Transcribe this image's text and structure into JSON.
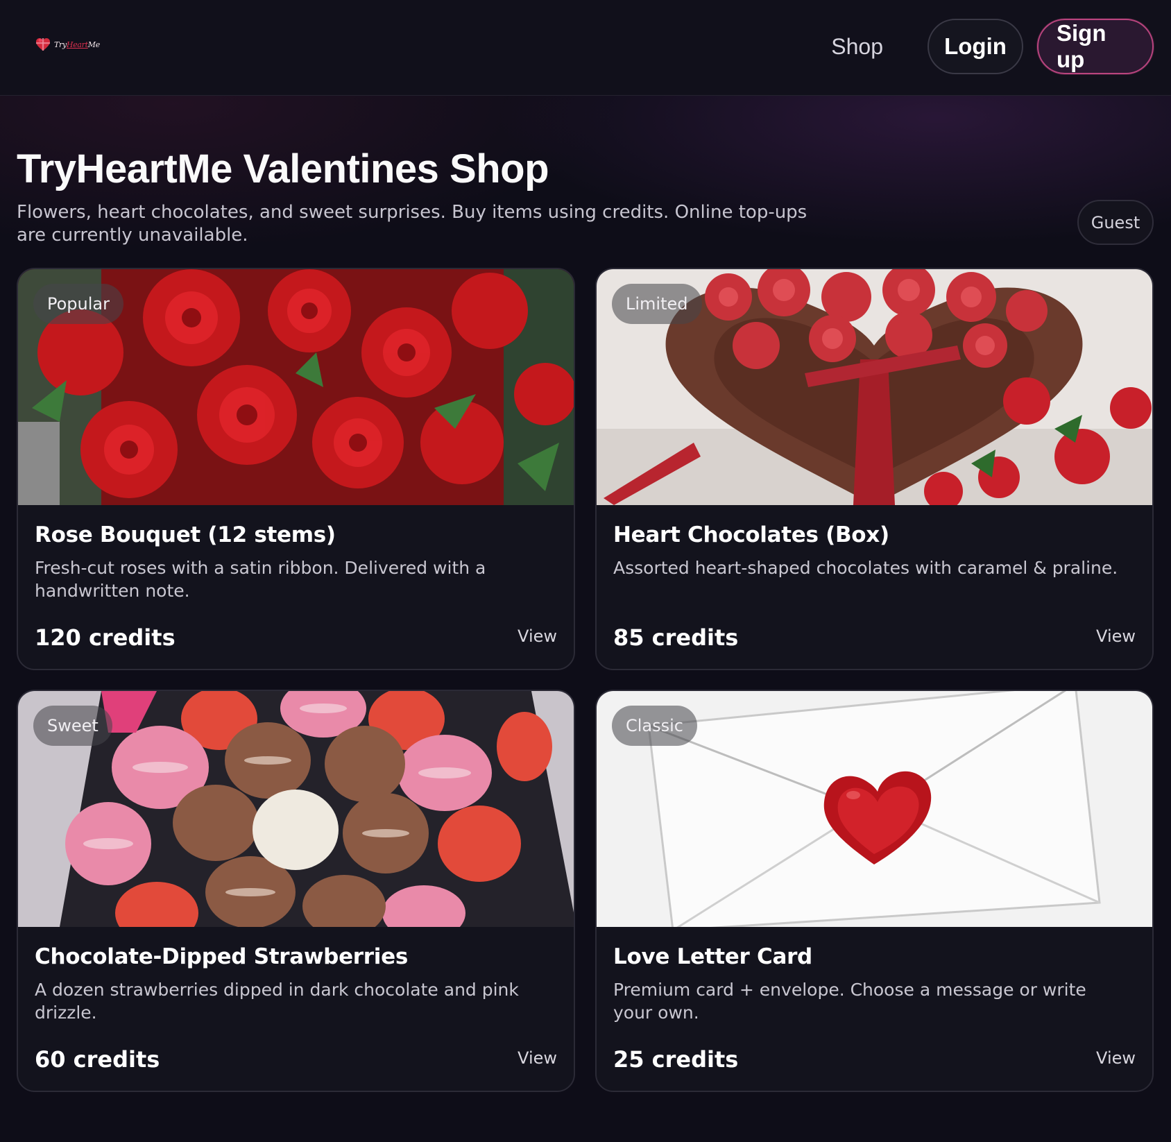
{
  "header": {
    "logo_text_pre": "Try",
    "logo_text_accent": "Heart",
    "logo_text_post": "Me",
    "nav_shop": "Shop",
    "login_label": "Login",
    "signup_label": "Sign up"
  },
  "hero": {
    "title": "TryHeartMe Valentines Shop",
    "subtitle": "Flowers, heart chocolates, and sweet surprises. Buy items using credits. Online top-ups are currently unavailable.",
    "user_badge": "Guest"
  },
  "products": [
    {
      "tag": "Popular",
      "title": "Rose Bouquet (12 stems)",
      "description": "Fresh-cut roses with a satin ribbon. Delivered with a handwritten note.",
      "price": "120 credits",
      "action": "View"
    },
    {
      "tag": "Limited",
      "title": "Heart Chocolates (Box)",
      "description": "Assorted heart-shaped chocolates with caramel & praline.",
      "price": "85 credits",
      "action": "View"
    },
    {
      "tag": "Sweet",
      "title": "Chocolate-Dipped Strawberries",
      "description": "A dozen strawberries dipped in dark chocolate and pink drizzle.",
      "price": "60 credits",
      "action": "View"
    },
    {
      "tag": "Classic",
      "title": "Love Letter Card",
      "description": "Premium card + envelope. Choose a message or write your own.",
      "price": "25 credits",
      "action": "View"
    }
  ],
  "colors": {
    "background": "#0e0d18",
    "card": "#13131d",
    "accent": "#b9447e"
  }
}
